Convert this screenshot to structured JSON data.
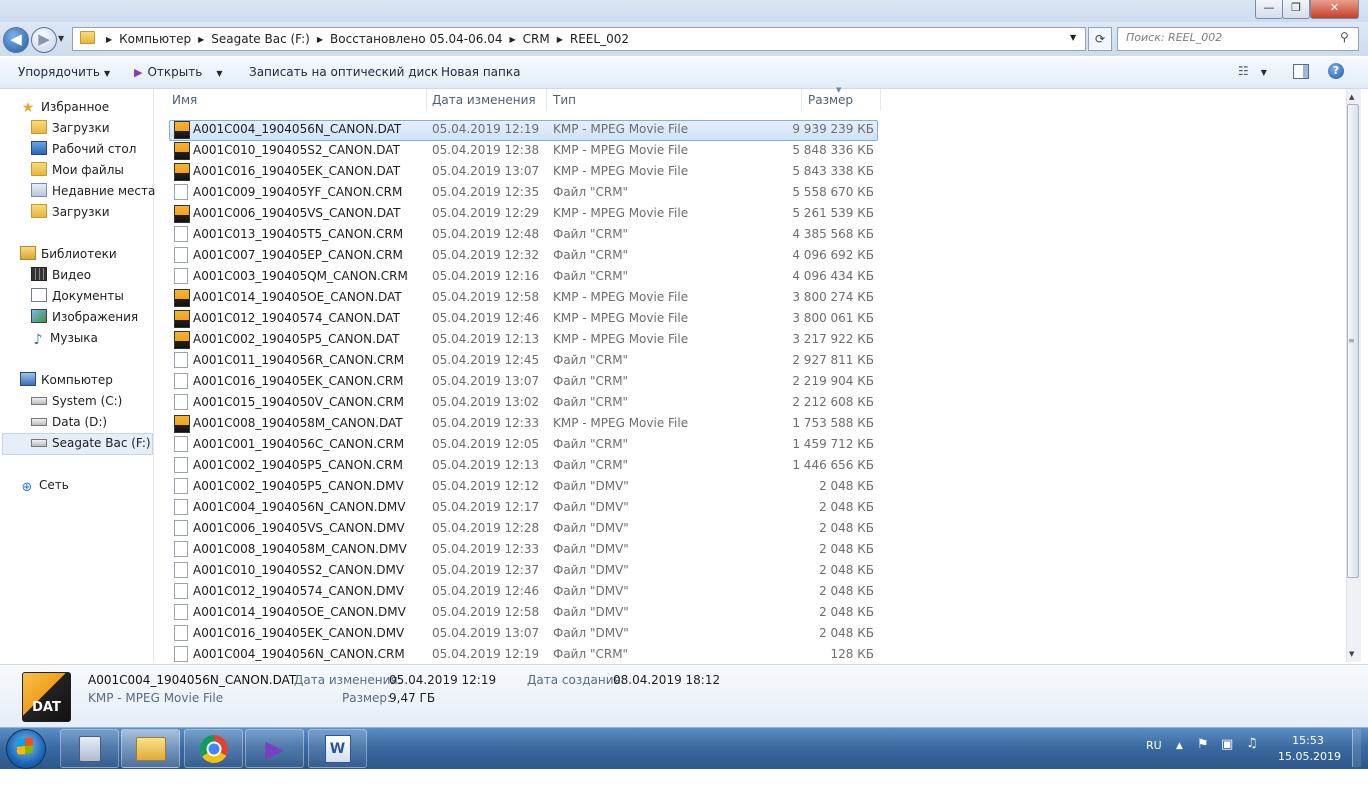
{
  "window": {
    "controls": {
      "minimize": "—",
      "maximize": "❐",
      "close": "✕"
    }
  },
  "address": {
    "crumbs": [
      "Компьютер",
      "Seagate Bac (F:)",
      "Восстановлено 05.04-06.04",
      "CRM",
      "REEL_002"
    ],
    "search_placeholder": "Поиск: REEL_002"
  },
  "toolbar": {
    "organize": "Упорядочить",
    "open": "Открыть",
    "burn": "Записать на оптический диск",
    "new_folder": "Новая папка"
  },
  "nav": {
    "favorites": "Избранное",
    "favorites_items": [
      "Загрузки",
      "Рабочий стол",
      "Мои файлы",
      "Недавние места",
      "Загрузки"
    ],
    "libraries": "Библиотеки",
    "libraries_items": [
      "Видео",
      "Документы",
      "Изображения",
      "Музыка"
    ],
    "computer": "Компьютер",
    "computer_items": [
      "System (C:)",
      "Data (D:)",
      "Seagate Bac (F:)"
    ],
    "network": "Сеть"
  },
  "columns": {
    "name": "Имя",
    "date": "Дата изменения",
    "type": "Тип",
    "size": "Размер"
  },
  "files": [
    {
      "name": "A001C004_1904056N_CANON.DAT",
      "date": "05.04.2019 12:19",
      "type": "KMP - MPEG Movie File",
      "size": "9 939 239 КБ",
      "icon": "dat-icon"
    },
    {
      "name": "A001C010_190405S2_CANON.DAT",
      "date": "05.04.2019 12:38",
      "type": "KMP - MPEG Movie File",
      "size": "5 848 336 КБ",
      "icon": "dat-icon"
    },
    {
      "name": "A001C016_190405EK_CANON.DAT",
      "date": "05.04.2019 13:07",
      "type": "KMP - MPEG Movie File",
      "size": "5 843 338 КБ",
      "icon": "dat-icon"
    },
    {
      "name": "A001C009_190405YF_CANON.CRM",
      "date": "05.04.2019 12:35",
      "type": "Файл \"CRM\"",
      "size": "5 558 670 КБ",
      "icon": "file-icon"
    },
    {
      "name": "A001C006_190405VS_CANON.DAT",
      "date": "05.04.2019 12:29",
      "type": "KMP - MPEG Movie File",
      "size": "5 261 539 КБ",
      "icon": "dat-icon"
    },
    {
      "name": "A001C013_190405T5_CANON.CRM",
      "date": "05.04.2019 12:48",
      "type": "Файл \"CRM\"",
      "size": "4 385 568 КБ",
      "icon": "file-icon"
    },
    {
      "name": "A001C007_190405EP_CANON.CRM",
      "date": "05.04.2019 12:32",
      "type": "Файл \"CRM\"",
      "size": "4 096 692 КБ",
      "icon": "file-icon"
    },
    {
      "name": "A001C003_190405QM_CANON.CRM",
      "date": "05.04.2019 12:16",
      "type": "Файл \"CRM\"",
      "size": "4 096 434 КБ",
      "icon": "file-icon"
    },
    {
      "name": "A001C014_190405OE_CANON.DAT",
      "date": "05.04.2019 12:58",
      "type": "KMP - MPEG Movie File",
      "size": "3 800 274 КБ",
      "icon": "dat-icon"
    },
    {
      "name": "A001C012_19040574_CANON.DAT",
      "date": "05.04.2019 12:46",
      "type": "KMP - MPEG Movie File",
      "size": "3 800 061 КБ",
      "icon": "dat-icon"
    },
    {
      "name": "A001C002_190405P5_CANON.DAT",
      "date": "05.04.2019 12:13",
      "type": "KMP - MPEG Movie File",
      "size": "3 217 922 КБ",
      "icon": "dat-icon"
    },
    {
      "name": "A001C011_1904056R_CANON.CRM",
      "date": "05.04.2019 12:45",
      "type": "Файл \"CRM\"",
      "size": "2 927 811 КБ",
      "icon": "file-icon"
    },
    {
      "name": "A001C016_190405EK_CANON.CRM",
      "date": "05.04.2019 13:07",
      "type": "Файл \"CRM\"",
      "size": "2 219 904 КБ",
      "icon": "file-icon"
    },
    {
      "name": "A001C015_1904050V_CANON.CRM",
      "date": "05.04.2019 13:02",
      "type": "Файл \"CRM\"",
      "size": "2 212 608 КБ",
      "icon": "file-icon"
    },
    {
      "name": "A001C008_1904058M_CANON.DAT",
      "date": "05.04.2019 12:33",
      "type": "KMP - MPEG Movie File",
      "size": "1 753 588 КБ",
      "icon": "dat-icon"
    },
    {
      "name": "A001C001_1904056C_CANON.CRM",
      "date": "05.04.2019 12:05",
      "type": "Файл \"CRM\"",
      "size": "1 459 712 КБ",
      "icon": "file-icon"
    },
    {
      "name": "A001C002_190405P5_CANON.CRM",
      "date": "05.04.2019 12:13",
      "type": "Файл \"CRM\"",
      "size": "1 446 656 КБ",
      "icon": "file-icon"
    },
    {
      "name": "A001C002_190405P5_CANON.DMV",
      "date": "05.04.2019 12:12",
      "type": "Файл \"DMV\"",
      "size": "2 048 КБ",
      "icon": "file-icon"
    },
    {
      "name": "A001C004_1904056N_CANON.DMV",
      "date": "05.04.2019 12:17",
      "type": "Файл \"DMV\"",
      "size": "2 048 КБ",
      "icon": "file-icon"
    },
    {
      "name": "A001C006_190405VS_CANON.DMV",
      "date": "05.04.2019 12:28",
      "type": "Файл \"DMV\"",
      "size": "2 048 КБ",
      "icon": "file-icon"
    },
    {
      "name": "A001C008_1904058M_CANON.DMV",
      "date": "05.04.2019 12:33",
      "type": "Файл \"DMV\"",
      "size": "2 048 КБ",
      "icon": "file-icon"
    },
    {
      "name": "A001C010_190405S2_CANON.DMV",
      "date": "05.04.2019 12:37",
      "type": "Файл \"DMV\"",
      "size": "2 048 КБ",
      "icon": "file-icon"
    },
    {
      "name": "A001C012_19040574_CANON.DMV",
      "date": "05.04.2019 12:46",
      "type": "Файл \"DMV\"",
      "size": "2 048 КБ",
      "icon": "file-icon"
    },
    {
      "name": "A001C014_190405OE_CANON.DMV",
      "date": "05.04.2019 12:58",
      "type": "Файл \"DMV\"",
      "size": "2 048 КБ",
      "icon": "file-icon"
    },
    {
      "name": "A001C016_190405EK_CANON.DMV",
      "date": "05.04.2019 13:07",
      "type": "Файл \"DMV\"",
      "size": "2 048 КБ",
      "icon": "file-icon"
    },
    {
      "name": "A001C004_1904056N_CANON.CRM",
      "date": "05.04.2019 12:19",
      "type": "Файл \"CRM\"",
      "size": "128 КБ",
      "icon": "file-icon"
    }
  ],
  "details": {
    "icon_tag": "DAT",
    "filename": "A001C004_1904056N_CANON.DAT",
    "type": "KMP - MPEG Movie File",
    "modified_label": "Дата изменения:",
    "modified": "05.04.2019 12:19",
    "created_label": "Дата создания:",
    "created": "08.04.2019 18:12",
    "size_label": "Размер:",
    "size": "9,47 ГБ"
  },
  "taskbar": {
    "lang": "RU",
    "time": "15:53",
    "date": "15.05.2019",
    "apps": [
      "calculator-icon",
      "explorer-icon",
      "chrome-icon",
      "video-player-icon",
      "word-icon"
    ]
  },
  "colors": {
    "selection": "#cfe2f8",
    "taskbar": "#3a6aa1",
    "header_text": "#4c607a"
  }
}
